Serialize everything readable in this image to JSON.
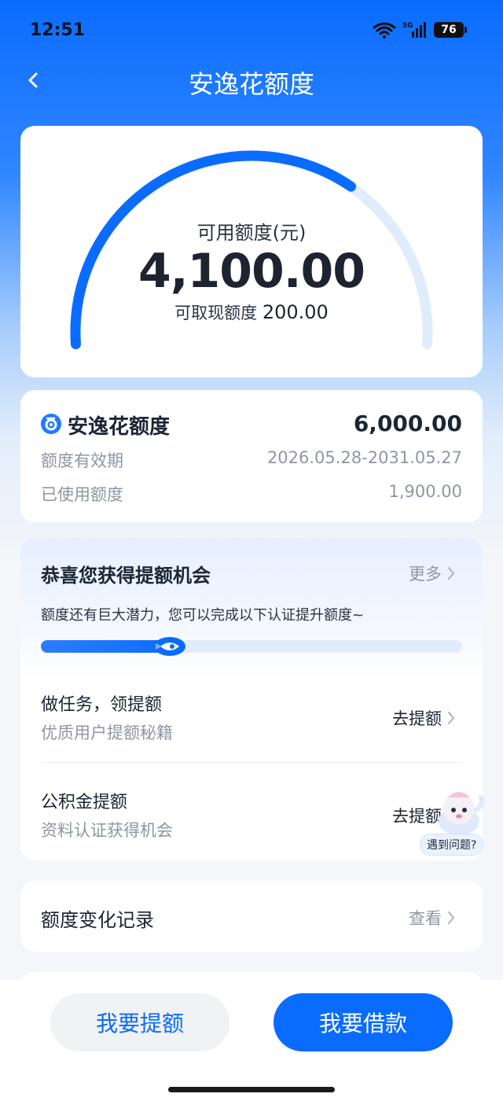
{
  "status_bar": {
    "time": "12:51",
    "network": "5G",
    "battery": "76"
  },
  "nav": {
    "title": "安逸花额度"
  },
  "gauge": {
    "label": "可用额度(元)",
    "amount": "4,100.00",
    "cash_label": "可取现额度",
    "cash_value": "200.00",
    "used_fraction": 0.683
  },
  "limit_info": {
    "title": "安逸花额度",
    "total": "6,000.00",
    "rows": [
      {
        "label": "额度有效期",
        "value": "2026.05.28-2031.05.27"
      },
      {
        "label": "已使用额度",
        "value": "1,900.00"
      }
    ]
  },
  "promo": {
    "title": "恭喜您获得提额机会",
    "more": "更多",
    "description": "额度还有巨大潜力，您可以完成以下认证提升额度~",
    "progress_fraction": 0.34,
    "tasks": [
      {
        "title": "做任务，领提额",
        "subtitle": "优质用户提额秘籍",
        "action": "去提额"
      },
      {
        "title": "公积金提额",
        "subtitle": "资料认证获得机会",
        "action": "去提额"
      }
    ]
  },
  "record": {
    "title": "额度变化记录",
    "action": "查看"
  },
  "helper": {
    "label": "遇到问题?"
  },
  "bottom": {
    "raise_label": "我要提额",
    "borrow_label": "我要借款"
  },
  "colors": {
    "primary": "#0a6cff",
    "track": "#e1ecfb",
    "text": "#1b2533",
    "muted": "#8e96a3"
  }
}
